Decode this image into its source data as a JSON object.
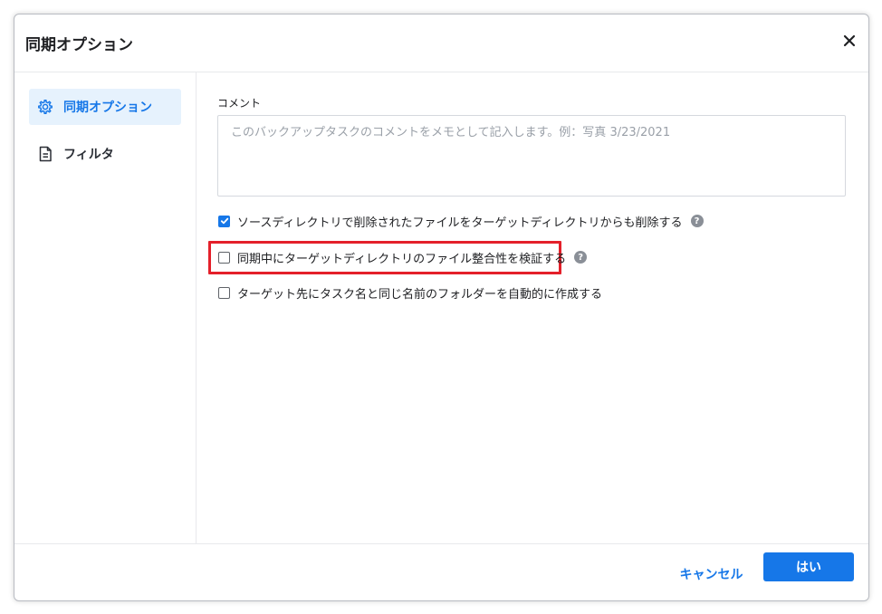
{
  "dialog": {
    "title": "同期オプション",
    "close_icon": "close-icon"
  },
  "sidebar": {
    "items": [
      {
        "label": "同期オプション",
        "icon": "gear-icon",
        "active": true
      },
      {
        "label": "フィルタ",
        "icon": "document-icon",
        "active": false
      }
    ]
  },
  "comment": {
    "label": "コメント",
    "placeholder": "このバックアップタスクのコメントをメモとして記入します。例：写真 3/23/2021",
    "value": ""
  },
  "options": [
    {
      "label": "ソースディレクトリで削除されたファイルをターゲットディレクトリからも削除する",
      "checked": true,
      "help": true
    },
    {
      "label": "同期中にターゲットディレクトリのファイル整合性を検証する",
      "checked": false,
      "help": true,
      "highlighted": true
    },
    {
      "label": "ターゲット先にタスク名と同じ名前のフォルダーを自動的に作成する",
      "checked": false,
      "help": false
    }
  ],
  "footer": {
    "cancel_label": "キャンセル",
    "ok_label": "はい"
  },
  "colors": {
    "accent": "#1677e8",
    "active_nav_bg": "#e6f2fd",
    "highlight": "#e4202a",
    "help_icon": "#8a8f97"
  }
}
